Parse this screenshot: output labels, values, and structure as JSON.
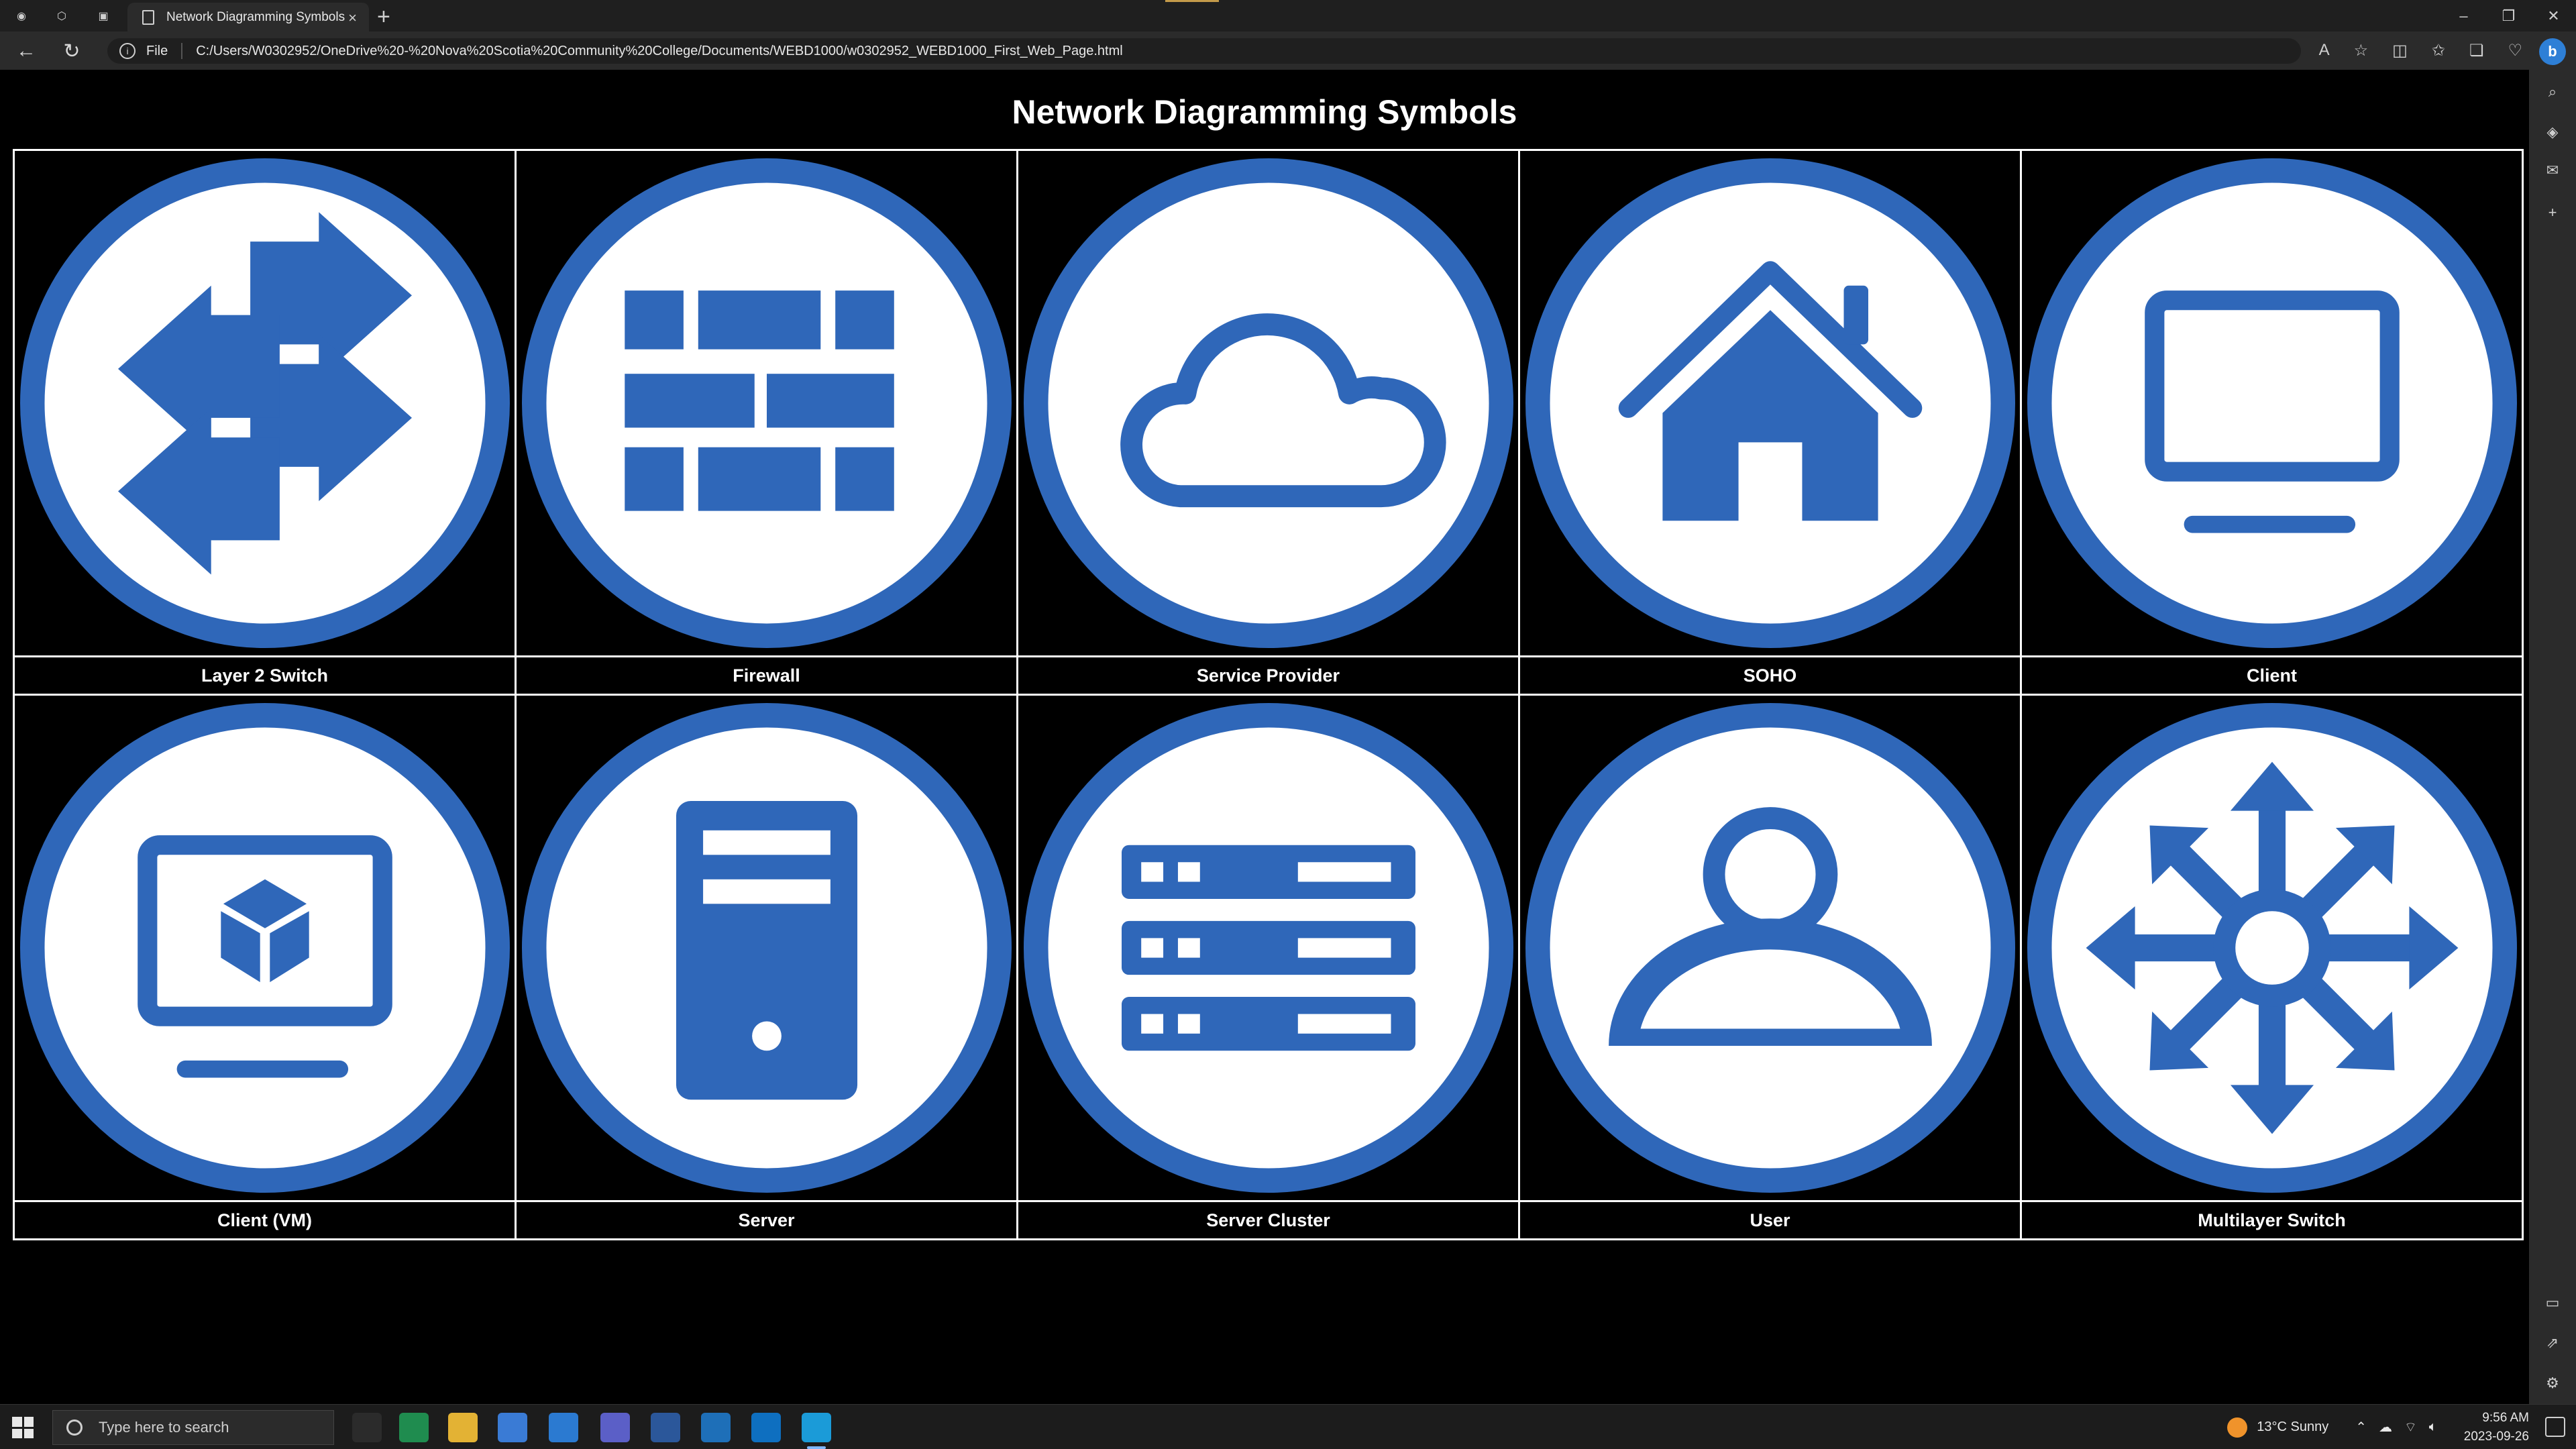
{
  "browser": {
    "tab_title": "Network Diagramming Symbols",
    "tab_close": "×",
    "new_tab": "+",
    "address_prefix": "File",
    "address_url": "C:/Users/W0302952/OneDrive%20-%20Nova%20Scotia%20Community%20College/Documents/WEBD1000/w0302952_WEBD1000_First_Web_Page.html",
    "window_controls": [
      "–",
      "❐",
      "✕"
    ]
  },
  "page": {
    "title": "Network Diagramming Symbols",
    "icon_color": "#2f67b9",
    "rows": [
      [
        {
          "label": "Layer 2 Switch",
          "icon": "layer2-switch-icon"
        },
        {
          "label": "Firewall",
          "icon": "firewall-icon"
        },
        {
          "label": "Service Provider",
          "icon": "cloud-icon"
        },
        {
          "label": "SOHO",
          "icon": "house-icon"
        },
        {
          "label": "Client",
          "icon": "monitor-icon"
        }
      ],
      [
        {
          "label": "Client (VM)",
          "icon": "vm-monitor-icon"
        },
        {
          "label": "Server",
          "icon": "server-tower-icon"
        },
        {
          "label": "Server Cluster",
          "icon": "server-rack-icon"
        },
        {
          "label": "User",
          "icon": "user-icon"
        },
        {
          "label": "Multilayer Switch",
          "icon": "multilayer-switch-icon"
        }
      ]
    ]
  },
  "taskbar": {
    "search_placeholder": "Type here to search",
    "weather": "13°C  Sunny",
    "time": "9:56 AM",
    "date": "2023-09-26"
  }
}
